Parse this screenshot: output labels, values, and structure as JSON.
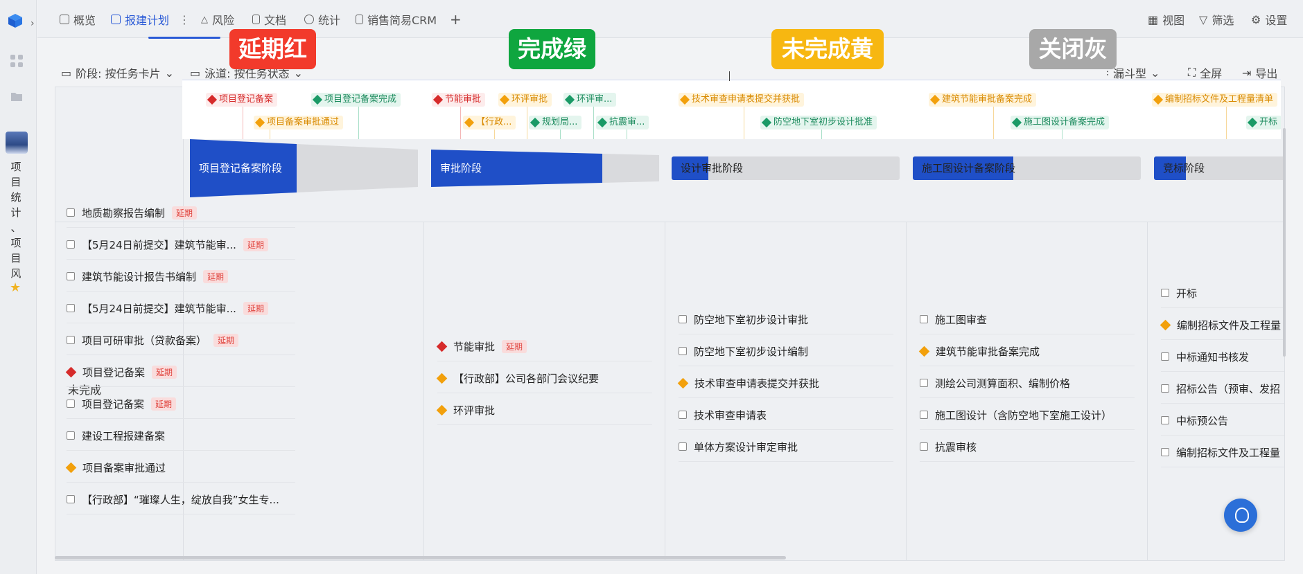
{
  "sidebar": {
    "project_title_vertical": [
      "项",
      "目",
      "统",
      "计",
      "、",
      "项",
      "目",
      "风"
    ]
  },
  "nav": {
    "tabs": [
      {
        "label": "概览",
        "icon": "overview-icon"
      },
      {
        "label": "报建计划",
        "icon": "plan-icon",
        "active": true
      },
      {
        "label": "风险",
        "icon": "warning-icon"
      },
      {
        "label": "文档",
        "icon": "document-icon"
      },
      {
        "label": "统计",
        "icon": "pie-chart-icon"
      },
      {
        "label": "销售简易CRM",
        "icon": "crm-icon"
      }
    ],
    "more": "⋮",
    "add": "+",
    "right": {
      "view": "视图",
      "filter": "筛选",
      "settings": "设置"
    }
  },
  "toolbar": {
    "stage": "阶段: 按任务卡片",
    "swimlane": "泳道: 按任务状态",
    "funnel": "漏斗型",
    "fullscreen": "全屏",
    "export": "导出"
  },
  "legend": [
    {
      "label": "延期红",
      "color": "#f23a2b"
    },
    {
      "label": "完成绿",
      "color": "#0fa63f"
    },
    {
      "label": "未完成黄",
      "color": "#f7b711"
    },
    {
      "label": "关闭灰",
      "color": "#a8a8a8"
    }
  ],
  "stages": [
    {
      "label": "项目登记备案阶段",
      "progress": 0.5
    },
    {
      "label": "审批阶段",
      "progress": 0.75
    },
    {
      "label": "设计审批阶段",
      "progress": 0.16
    },
    {
      "label": "施工图设计备案阶段",
      "progress": 0.44
    },
    {
      "label": "竞标阶段",
      "progress": 0.25
    }
  ],
  "milestones": {
    "row1": [
      {
        "label": "项目登记备案",
        "status": "red"
      },
      {
        "label": "项目登记备案完成",
        "status": "green"
      },
      {
        "label": "节能审批",
        "status": "red"
      },
      {
        "label": "环评审批",
        "status": "yellow"
      },
      {
        "label": "环评审...",
        "status": "green"
      },
      {
        "label": "技术审查申请表提交并获批",
        "status": "yellow"
      },
      {
        "label": "建筑节能审批备案完成",
        "status": "yellow"
      },
      {
        "label": "编制招标文件及工程量清单",
        "status": "yellow"
      }
    ],
    "row2": [
      {
        "label": "项目备案审批通过",
        "status": "yellow"
      },
      {
        "label": "【行政...",
        "status": "yellow"
      },
      {
        "label": "规划局...",
        "status": "green"
      },
      {
        "label": "抗震审...",
        "status": "green"
      },
      {
        "label": "防空地下室初步设计批准",
        "status": "green"
      },
      {
        "label": "施工图设计备案完成",
        "status": "green"
      },
      {
        "label": "开标",
        "status": "green"
      }
    ]
  },
  "swimlane": {
    "label": "未完成"
  },
  "columns": [
    [
      {
        "kind": "checkbox",
        "text": "地质勘察报告编制",
        "badge": "延期"
      },
      {
        "kind": "checkbox",
        "text": "【5月24日前提交】建筑节能审...",
        "badge": "延期"
      },
      {
        "kind": "checkbox",
        "text": "建筑节能设计报告书编制",
        "badge": "延期"
      },
      {
        "kind": "checkbox",
        "text": "【5月24日前提交】建筑节能审...",
        "badge": "延期"
      },
      {
        "kind": "checkbox",
        "text": "项目可研审批（贷款备案）",
        "badge": "延期"
      },
      {
        "kind": "diamond-red",
        "text": "项目登记备案",
        "badge": "延期"
      },
      {
        "kind": "checkbox",
        "text": "项目登记备案",
        "badge": "延期"
      },
      {
        "kind": "checkbox",
        "text": "建设工程报建备案",
        "badge": ""
      },
      {
        "kind": "diamond-yellow",
        "text": "项目备案审批通过",
        "badge": ""
      },
      {
        "kind": "checkbox",
        "text": "【行政部】“璀璨人生，绽放自我”女生专...",
        "badge": ""
      }
    ],
    [
      {
        "kind": "diamond-red",
        "text": "节能审批",
        "badge": "延期"
      },
      {
        "kind": "diamond-yellow",
        "text": "【行政部】公司各部门会议纪要",
        "badge": ""
      },
      {
        "kind": "diamond-yellow",
        "text": "环评审批",
        "badge": ""
      }
    ],
    [
      {
        "kind": "checkbox",
        "text": "防空地下室初步设计审批",
        "badge": ""
      },
      {
        "kind": "checkbox",
        "text": "防空地下室初步设计编制",
        "badge": ""
      },
      {
        "kind": "diamond-yellow",
        "text": "技术审查申请表提交并获批",
        "badge": ""
      },
      {
        "kind": "checkbox",
        "text": "技术审查申请表",
        "badge": ""
      },
      {
        "kind": "checkbox",
        "text": "单体方案设计审定审批",
        "badge": ""
      }
    ],
    [
      {
        "kind": "checkbox",
        "text": "施工图审查",
        "badge": ""
      },
      {
        "kind": "diamond-yellow",
        "text": "建筑节能审批备案完成",
        "badge": ""
      },
      {
        "kind": "checkbox",
        "text": "测绘公司测算面积、编制价格",
        "badge": ""
      },
      {
        "kind": "checkbox",
        "text": "施工图设计（含防空地下室施工设计）",
        "badge": ""
      },
      {
        "kind": "checkbox",
        "text": "抗震审核",
        "badge": ""
      }
    ],
    [
      {
        "kind": "checkbox",
        "text": "开标",
        "badge": ""
      },
      {
        "kind": "diamond-yellow",
        "text": "编制招标文件及工程量",
        "badge": ""
      },
      {
        "kind": "checkbox",
        "text": "中标通知书核发",
        "badge": ""
      },
      {
        "kind": "checkbox",
        "text": "招标公告（预审、发招",
        "badge": ""
      },
      {
        "kind": "checkbox",
        "text": "中标预公告",
        "badge": ""
      },
      {
        "kind": "checkbox",
        "text": "编制招标文件及工程量",
        "badge": ""
      }
    ]
  ]
}
